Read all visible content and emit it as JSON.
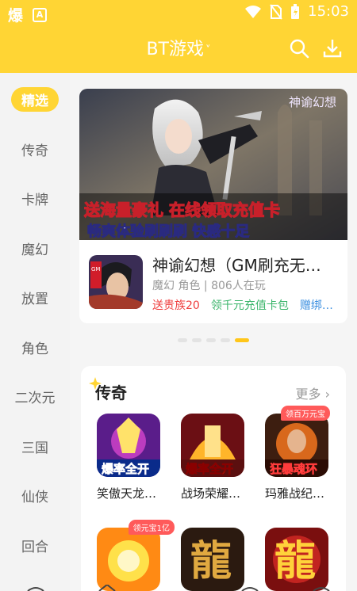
{
  "status": {
    "time": "15:03",
    "left_glyph": "爆",
    "a_label": "A"
  },
  "header": {
    "title": "BT游戏",
    "chevron": "˅"
  },
  "sidebar": {
    "items": [
      {
        "label": "精选",
        "active": true
      },
      {
        "label": "传奇"
      },
      {
        "label": "卡牌"
      },
      {
        "label": "魔幻"
      },
      {
        "label": "放置"
      },
      {
        "label": "角色"
      },
      {
        "label": "二次元"
      },
      {
        "label": "三国"
      },
      {
        "label": "仙侠"
      },
      {
        "label": "回合"
      }
    ]
  },
  "banner": {
    "logo_text": "神谕幻想",
    "line1": "送海量豪礼 在线领取充值卡",
    "line2": "畅爽体验刷刷刷 快感十足",
    "icon_text": "GM",
    "game_title": "神谕幻想（GM刷充无…",
    "meta": "魔幻 角色 | 806人在玩",
    "tags": [
      "送贵族20",
      "领千元充值卡包",
      "赠绑…"
    ]
  },
  "section": {
    "title": "传奇",
    "more": "更多 ›",
    "games": [
      {
        "label": "笑傲天龙…",
        "icon_text": "爆率全开"
      },
      {
        "label": "战场荣耀…",
        "icon_text": "爆率全开"
      },
      {
        "label": "玛雅战纪…",
        "icon_text": "狂暴魂环",
        "badge": "领百万元宝"
      },
      {
        "label": "",
        "badge": "领元宝1亿"
      },
      {
        "label": "",
        "icon_text": "龍"
      },
      {
        "label": "",
        "icon_text": "龍"
      }
    ]
  },
  "colors": {
    "brand": "#ffd534",
    "accent": "#ffc61a"
  }
}
